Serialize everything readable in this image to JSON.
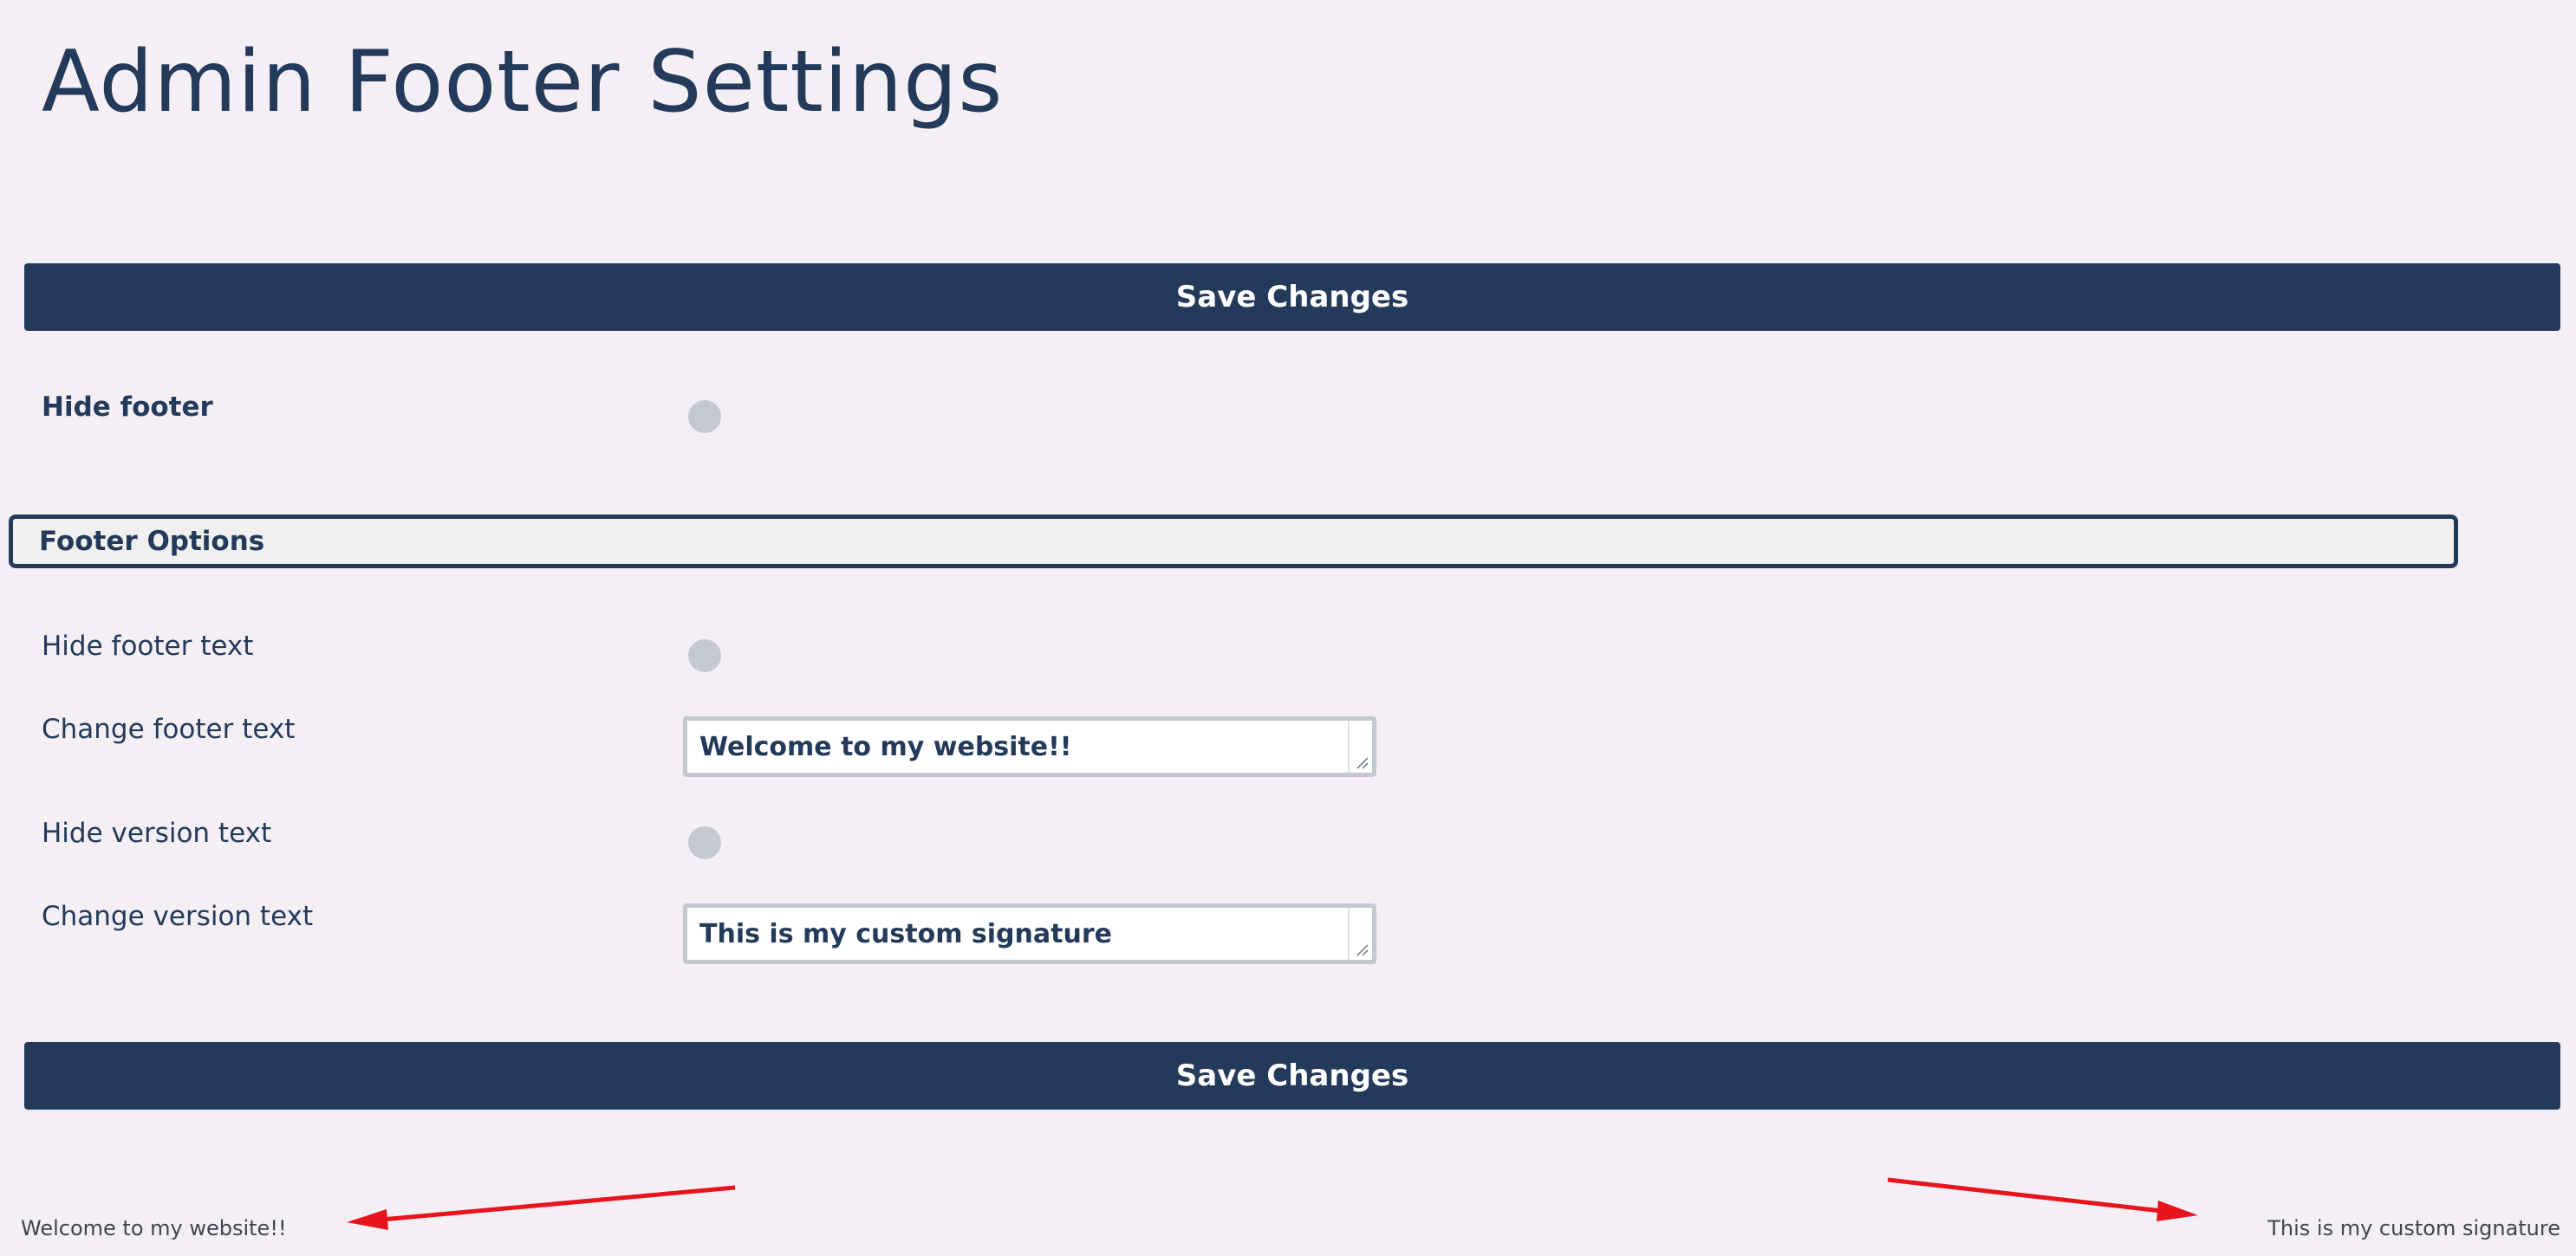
{
  "page": {
    "title": "Admin Footer Settings"
  },
  "actions": {
    "save_label": "Save Changes"
  },
  "settings": {
    "hide_footer": {
      "label": "Hide footer",
      "enabled": false
    }
  },
  "footer_options": {
    "section_title": "Footer Options",
    "hide_footer_text": {
      "label": "Hide footer text",
      "enabled": false
    },
    "change_footer_text": {
      "label": "Change footer text",
      "value": "Welcome to my website!!"
    },
    "hide_version_text": {
      "label": "Hide version text",
      "enabled": false
    },
    "change_version_text": {
      "label": "Change version text",
      "value": "This is my custom signature"
    }
  },
  "admin_footer": {
    "left_text": "Welcome to my website!!",
    "right_text": "This is my custom signature"
  },
  "colors": {
    "primary": "#243a5a",
    "background": "#f4eff4",
    "toggle_off": "#c3c8d1",
    "annotation_arrow": "#e8141d"
  },
  "icons": {
    "resize": "resize-grip-icon",
    "annotation": "red-arrow-icon"
  }
}
